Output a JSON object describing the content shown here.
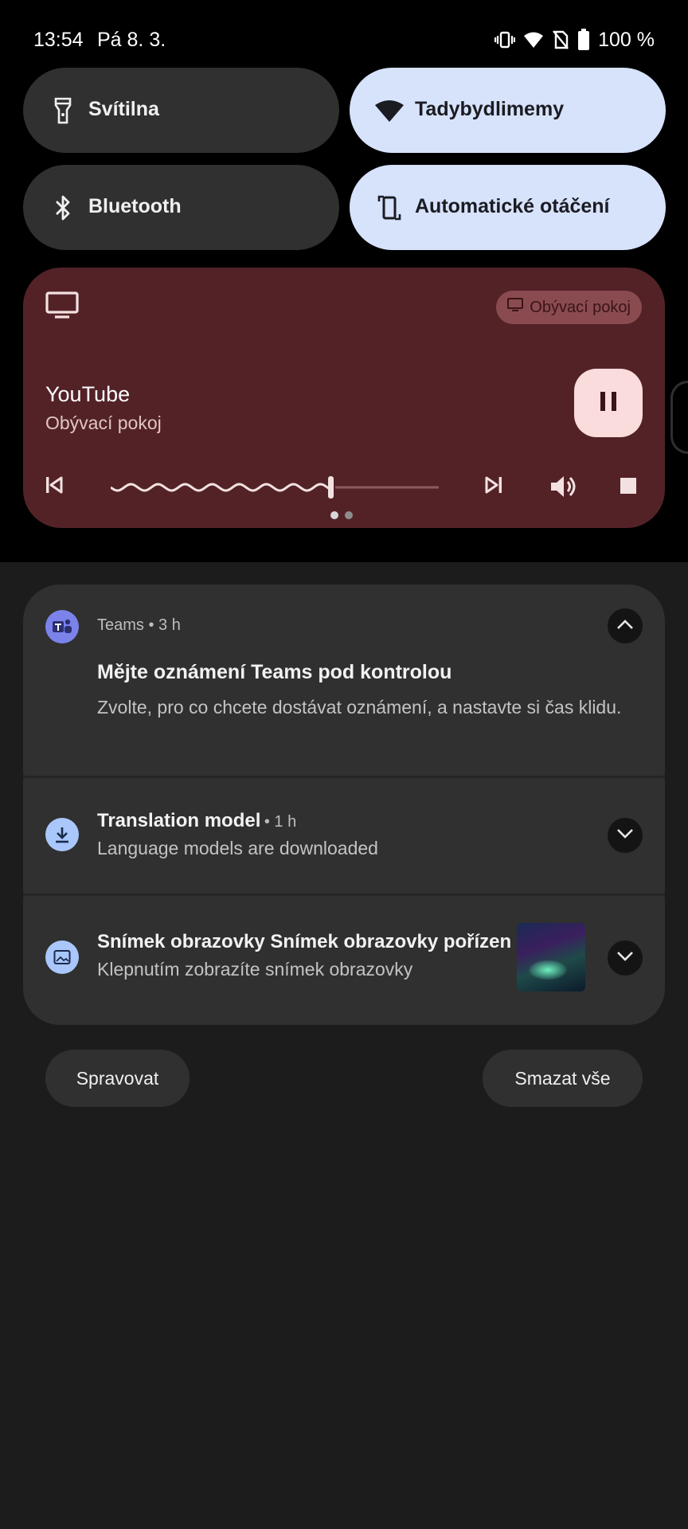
{
  "status_bar": {
    "time": "13:54",
    "date": "Pá 8. 3.",
    "battery": "100 %",
    "icons": [
      "vibrate-icon",
      "wifi-icon",
      "no-sim-icon",
      "battery-icon"
    ]
  },
  "quick_tiles": [
    {
      "label": "Svítilna",
      "icon": "flashlight-icon",
      "state": "off"
    },
    {
      "label": "Tadybydlimemy",
      "icon": "wifi-icon",
      "state": "on"
    },
    {
      "label": "Bluetooth",
      "icon": "bluetooth-icon",
      "state": "off"
    },
    {
      "label": "Automatické otáčení",
      "icon": "auto-rotate-icon",
      "state": "on"
    }
  ],
  "media": {
    "output_chip": "Obývací pokoj",
    "title": "YouTube",
    "subtitle": "Obývací pokoj",
    "progress": 0.67,
    "page": 1,
    "pages": 2,
    "colors": {
      "background": "#532227",
      "chip": "#8a4b50",
      "pause_button": "#fbdcdc"
    }
  },
  "notifications": [
    {
      "app": "Teams",
      "time": "3 h",
      "title": "Mějte oznámení Teams pod kontrolou",
      "text": "Zvolte, pro co chcete dostávat oznámení, a nastavte si čas klidu.",
      "icon": "teams-icon",
      "expanded": true
    },
    {
      "title": "Translation model",
      "time": "• 1 h",
      "text": "Language models are downloaded",
      "icon": "download-icon",
      "expanded": false
    },
    {
      "title": "Snímek obrazovky Snímek obrazovky pořízen",
      "text": "Klepnutím zobrazíte snímek obrazovky",
      "icon": "image-icon",
      "expanded": false
    }
  ],
  "buttons": {
    "manage": "Spravovat",
    "clear_all": "Smazat vše"
  }
}
